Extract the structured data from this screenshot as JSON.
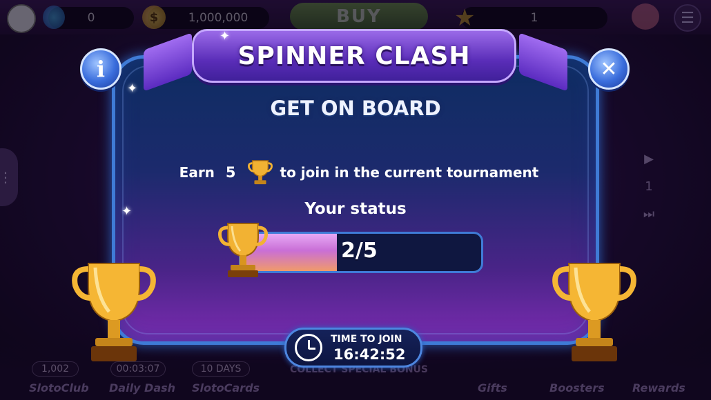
{
  "topbar": {
    "gems_value": "0",
    "coins_value": "1,000,000",
    "buy_label": "BUY",
    "level_value": "1",
    "coin_symbol": "$"
  },
  "side": {
    "right_counter": "1"
  },
  "bottombar": {
    "sloto_club_count": "1,002",
    "daily_dash_timer": "00:03:07",
    "sloto_cards_days": "10 DAYS",
    "collect_banner": "COLLECT SPECIAL BONUS",
    "labels": [
      "SlotoClub",
      "Daily Dash",
      "SlotoCards",
      "Gifts",
      "Boosters",
      "Rewards"
    ]
  },
  "modal": {
    "title": "SPINNER CLASH",
    "subtitle": "GET ON BOARD",
    "earn_prefix": "Earn",
    "earn_amount": "5",
    "earn_suffix": "to join in the current tournament",
    "status_label": "Your status",
    "progress_text": "2/5",
    "progress_fraction": 0.4,
    "timer_label": "TIME TO JOIN",
    "timer_value": "16:42:52",
    "info_glyph": "i",
    "close_glyph": "✕"
  },
  "colors": {
    "modal_border": "#3f7bd6",
    "title_banner": "#5a2db8",
    "progress_fill": "#c96fd6",
    "trophy_gold": "#f2b233"
  },
  "icons": [
    "info-icon",
    "close-icon",
    "trophy-icon",
    "clock-icon",
    "gem-icon",
    "coin-icon",
    "star-icon",
    "piggy-bank-icon",
    "menu-icon"
  ]
}
